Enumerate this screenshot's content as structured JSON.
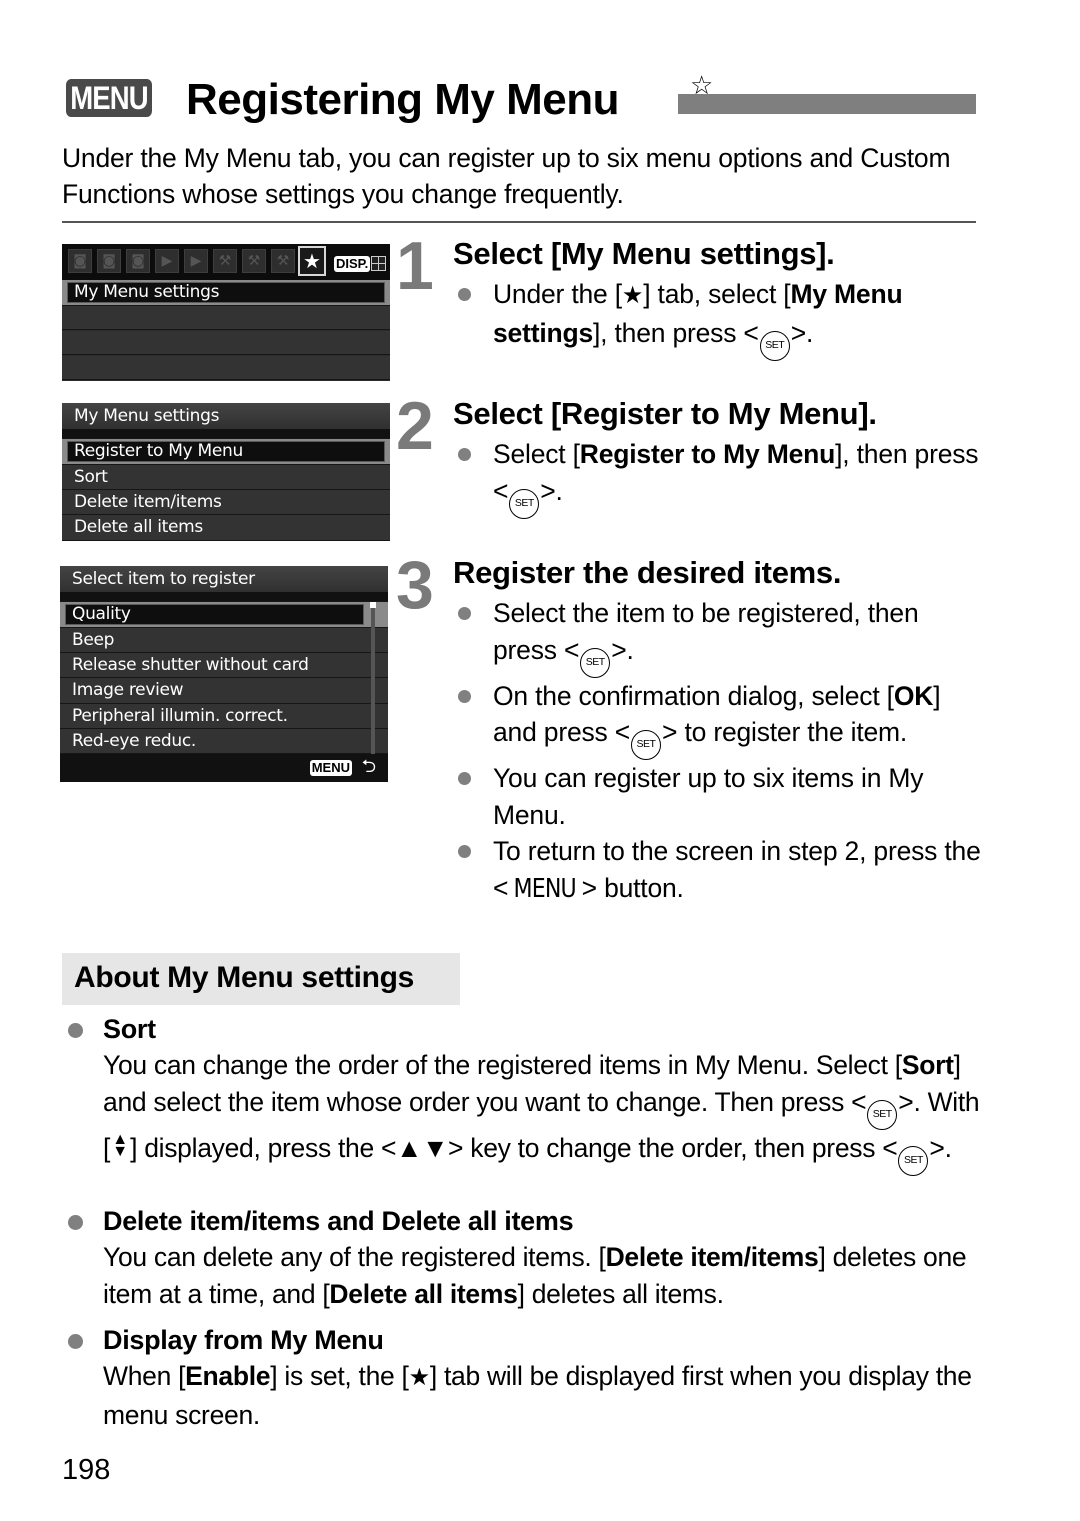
{
  "header": {
    "menu_badge": "MENU",
    "title": "Registering My Menu",
    "title_star": "☆",
    "intro": "Under the My Menu tab, you can register up to six menu options and Custom Functions whose settings you change frequently."
  },
  "screens": {
    "screen1": {
      "tab_icons": [
        "shooting-tab-1",
        "shooting-tab-2",
        "shooting-tab-3",
        "playback-tab-1",
        "playback-tab-2",
        "setup-tab-1",
        "setup-tab-2",
        "setup-tab-3",
        "my-menu-tab"
      ],
      "active_tab_glyph": "★",
      "disp_label": "DISP.",
      "items": [
        "My Menu settings",
        "",
        "",
        ""
      ]
    },
    "screen2": {
      "header": "My Menu settings",
      "items": [
        "Register to My Menu",
        "Sort",
        "Delete item/items",
        "Delete all items"
      ]
    },
    "screen3": {
      "header": "Select item to register",
      "items": [
        "Quality",
        "Beep",
        "Release shutter without card",
        "Image review",
        "Peripheral illumin. correct.",
        "Red-eye reduc."
      ],
      "footer_key": "MENU",
      "footer_back": "⮌"
    }
  },
  "steps": [
    {
      "number": "1",
      "title": "Select [My Menu settings].",
      "bullets": [
        {
          "t1": "Under the [",
          "star": "★",
          "t2": "] tab, select [",
          "b1": "My Menu settings",
          "t3": "], then press <",
          "set": "SET",
          "t4": ">."
        }
      ]
    },
    {
      "number": "2",
      "title": "Select [Register to My Menu].",
      "bullets": [
        {
          "t1": "Select [",
          "b1": "Register to My Menu",
          "t2": "], then press <",
          "set": "SET",
          "t3": ">."
        }
      ]
    },
    {
      "number": "3",
      "title": "Register the desired items.",
      "bullets": [
        {
          "t1": "Select the item to be registered, then press <",
          "set": "SET",
          "t2": ">."
        },
        {
          "t1": "On the confirmation dialog, select [",
          "b1": "OK",
          "t2": "] and press <",
          "set": "SET",
          "t3": "> to register the item."
        },
        {
          "t1": "You can register up to six items in My Menu."
        },
        {
          "t1": "To return to the screen in step 2, press the <",
          "menu": "MENU",
          "t2": "> button."
        }
      ]
    }
  ],
  "about": {
    "heading": "About My Menu settings",
    "sort": {
      "title": "Sort",
      "p1": "You can change the order of the registered items in My Menu. Select [",
      "b1": "Sort",
      "p2": "] and select the item whose order you want to change. Then press <",
      "set": "SET",
      "p3": ">. With [",
      "updown": "▲▼",
      "p4": "] displayed, press the <",
      "keys": "▲▼",
      "p5": "> key to change the order, then press <",
      "p6": ">."
    },
    "delete": {
      "title": "Delete item/items and Delete all items",
      "p1": "You can delete any of the registered items. [",
      "b1": "Delete item/items",
      "p2": "] deletes one item at a time, and [",
      "b2": "Delete all items",
      "p3": "] deletes all items."
    },
    "display": {
      "title": "Display from My Menu",
      "p1": "When [",
      "b1": "Enable",
      "p2": "] is set, the [",
      "star": "★",
      "p3": "] tab will be displayed first when you display the menu screen."
    }
  },
  "footer": {
    "page_number": "198"
  }
}
